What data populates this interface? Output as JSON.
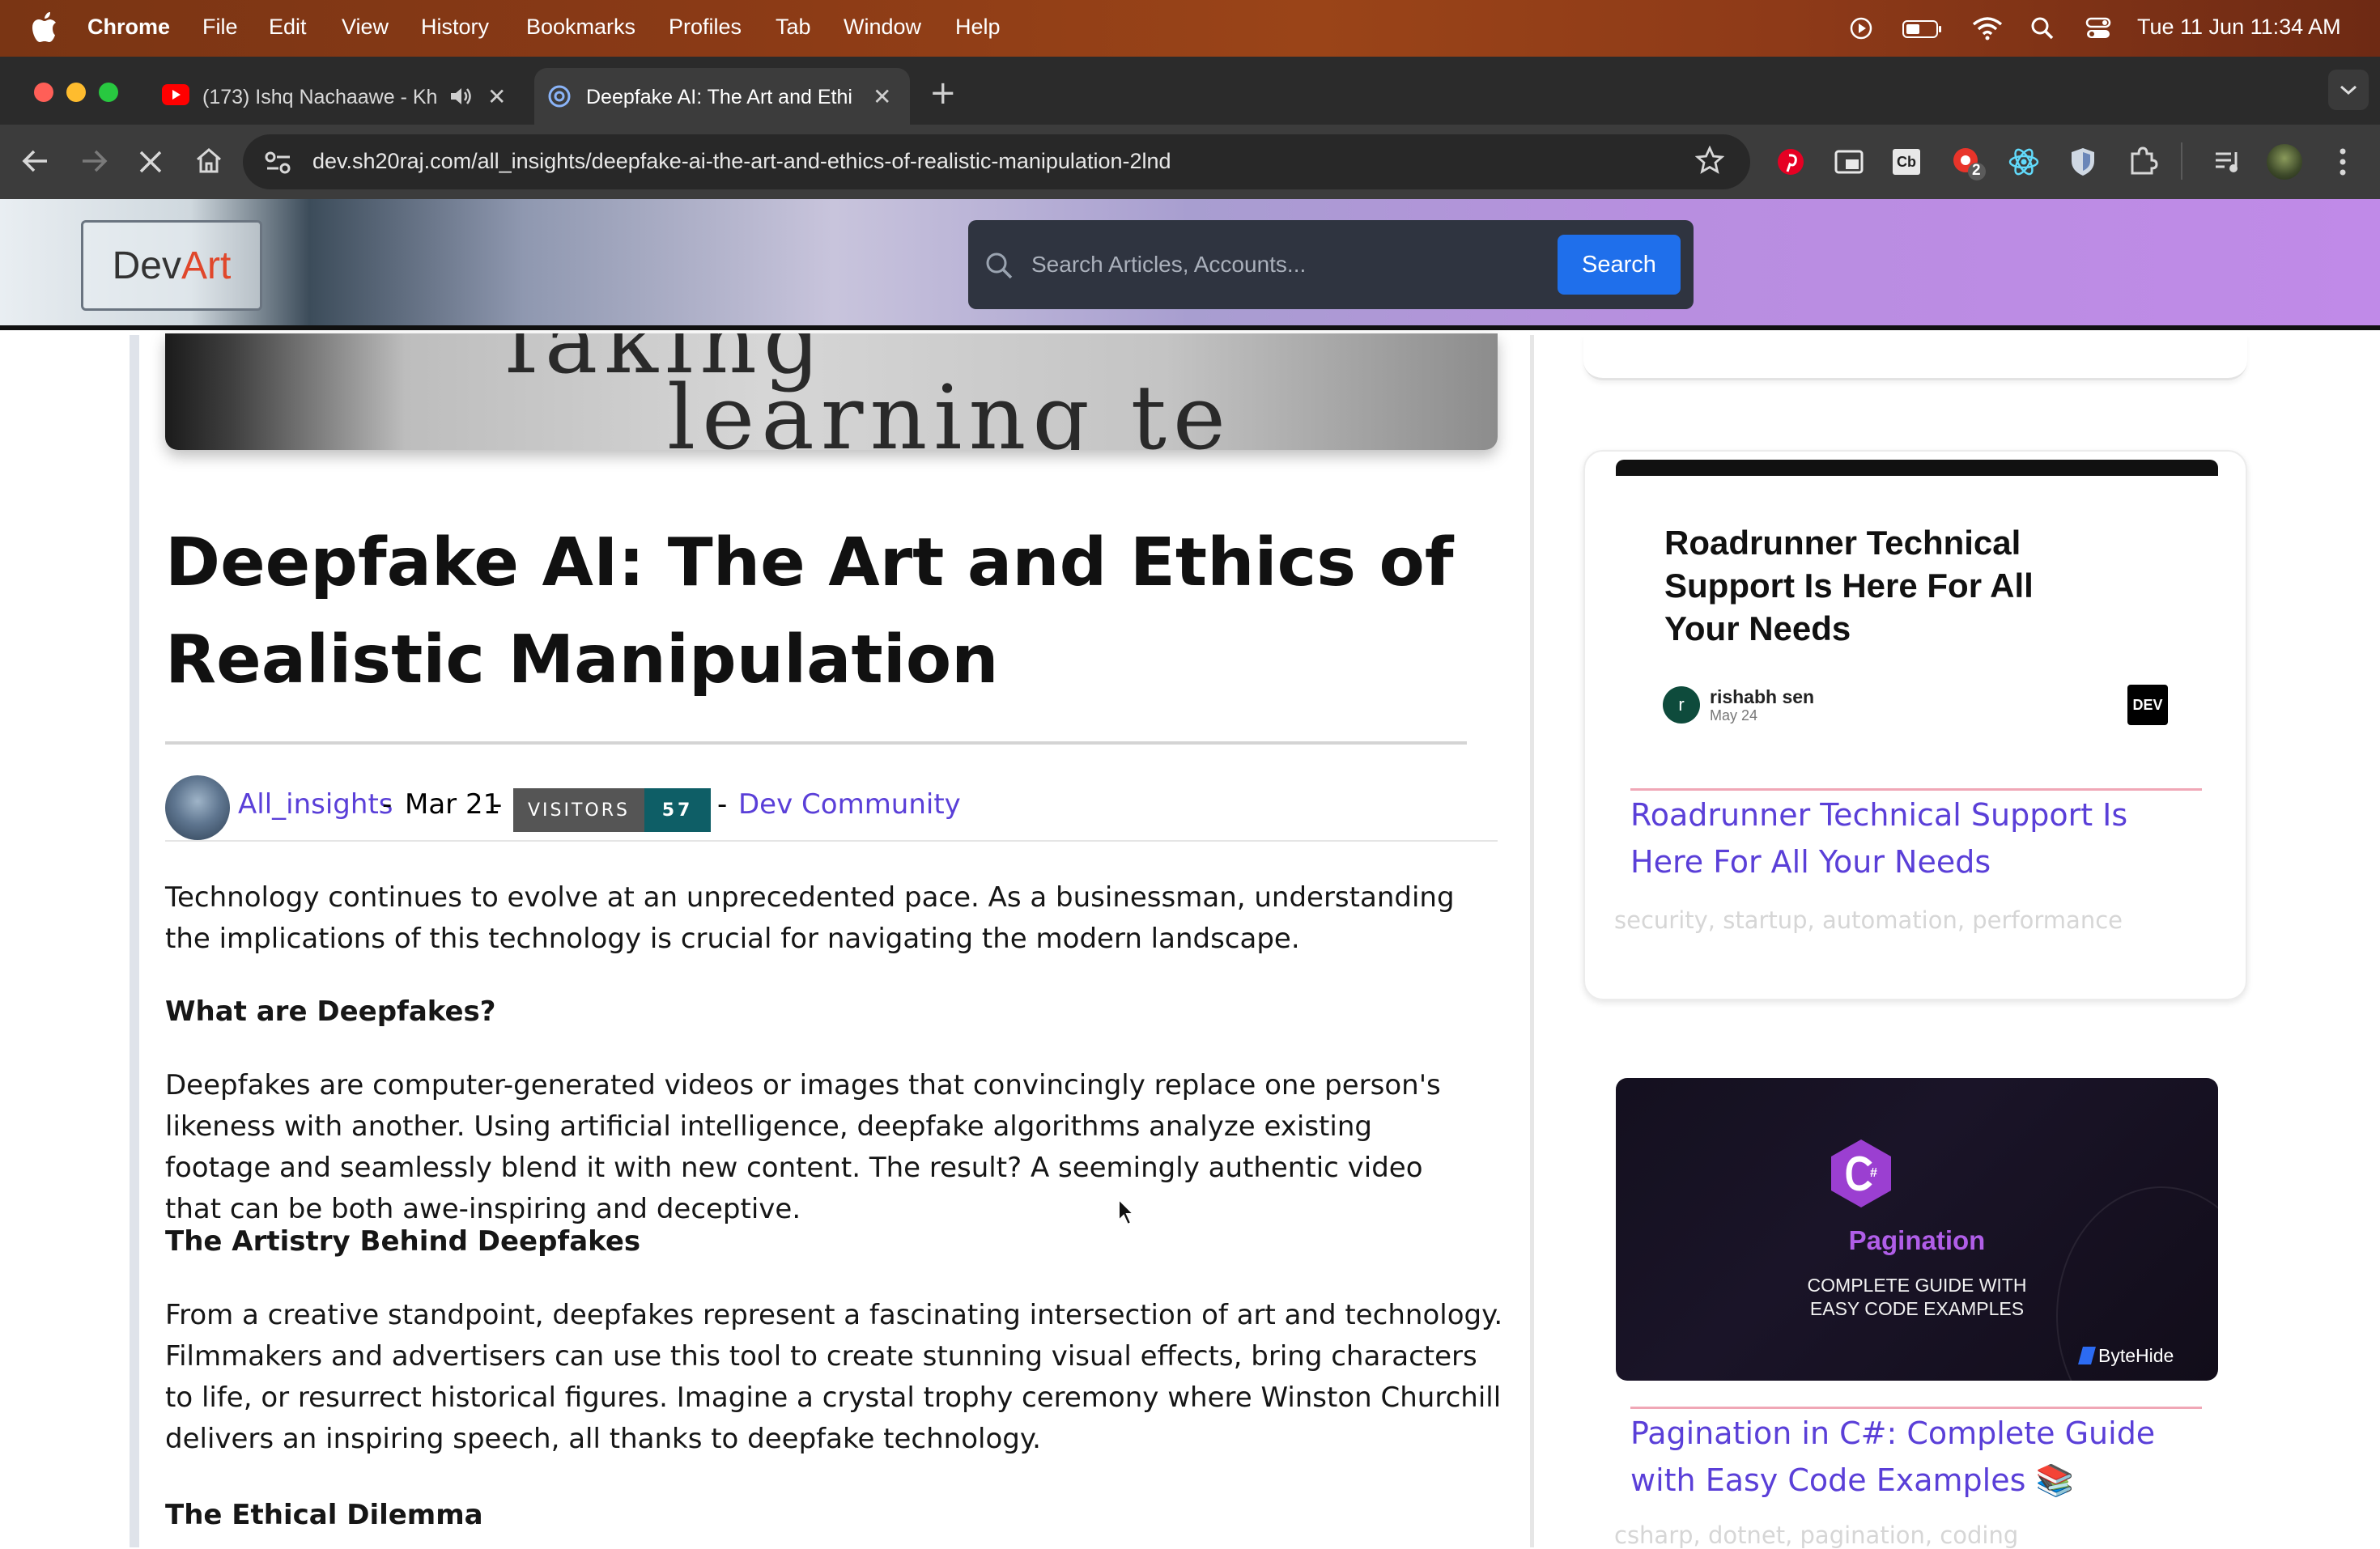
{
  "menubar": {
    "app": "Chrome",
    "items": [
      "File",
      "Edit",
      "View",
      "History",
      "Bookmarks",
      "Profiles",
      "Tab",
      "Window",
      "Help"
    ],
    "clock": "Tue 11 Jun  11:34 AM"
  },
  "tabs": [
    {
      "title": "(173) Ishq Nachaawe - Kh",
      "icon": "youtube-icon",
      "audio": true,
      "active": false
    },
    {
      "title": "Deepfake AI: The Art and Ethi",
      "icon": "site-favicon",
      "active": true
    }
  ],
  "toolbar": {
    "url": "dev.sh20raj.com/all_insights/deepfake-ai-the-art-and-ethics-of-realistic-manipulation-2lnd",
    "extension_badge": "2"
  },
  "site": {
    "logo_dev": "Dev",
    "logo_art": "Art",
    "search_placeholder": "Search Articles, Accounts...",
    "search_button": "Search"
  },
  "hero": {
    "line1": "faking",
    "line2": "learning te"
  },
  "article": {
    "title": "Deepfake AI: The Art and Ethics of Realistic Manipulation",
    "author": "All_insights",
    "date": "Mar 21",
    "sep1": "-",
    "sep2": "-",
    "sep3": "-",
    "visitors_label": "VISITORS",
    "visitors_count": "57",
    "community": "Dev Community",
    "intro": "Technology continues to evolve at an unprecedented pace. As a businessman, understanding the implications of this technology is crucial for navigating the modern landscape.",
    "sections": [
      {
        "heading": "What are Deepfakes?",
        "body": "Deepfakes are computer-generated videos or images that convincingly replace one person's likeness with another. Using artificial intelligence, deepfake algorithms analyze existing footage and seamlessly blend it with new content. The result? A seemingly authentic video that can be both awe-inspiring and deceptive."
      },
      {
        "heading": "The Artistry Behind Deepfakes",
        "body": "From a creative standpoint, deepfakes represent a fascinating intersection of art and technology. Filmmakers and advertisers can use this tool to create stunning visual effects, bring characters to life, or resurrect historical figures. Imagine a crystal trophy ceremony where Winston Churchill delivers an inspiring speech, all thanks to deepfake technology."
      },
      {
        "heading": "The Ethical Dilemma",
        "body": ""
      }
    ]
  },
  "sidebar": {
    "card2": {
      "image_heading": "Roadrunner Technical Support Is Here For All Your Needs",
      "author_initial": "r",
      "author": "rishabh sen",
      "date": "May 24",
      "platform": "DEV",
      "link": "Roadrunner Technical Support Is Here For All Your Needs",
      "tags": "security, startup, automation, performance"
    },
    "card3": {
      "image_title": "Pagination",
      "image_subtitle_1": "COMPLETE GUIDE WITH",
      "image_subtitle_2": "EASY CODE EXAMPLES",
      "brand": "ByteHide",
      "link": "Pagination in C#: Complete Guide with Easy Code Examples 📚",
      "tags": "csharp, dotnet, pagination, coding"
    }
  },
  "colors": {
    "link": "#5a3fd8",
    "search_button": "#1f6feb",
    "logo_art": "#e0472b",
    "visitors_count_bg": "#0e5e66"
  }
}
